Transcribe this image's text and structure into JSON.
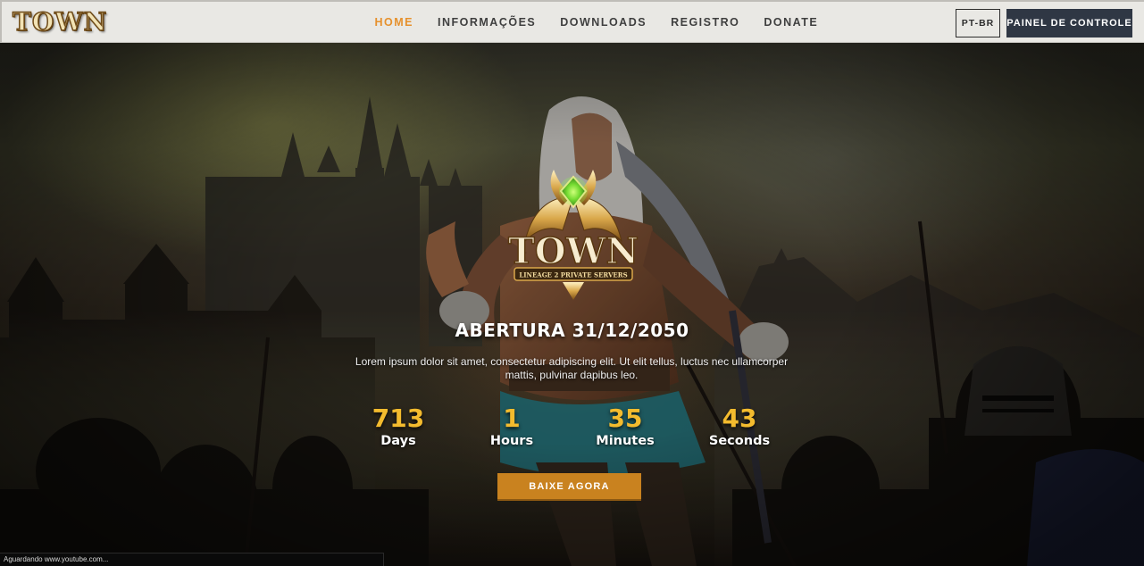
{
  "navbar": {
    "logo_text": "TOWN",
    "links": [
      {
        "label": "HOME",
        "active": true
      },
      {
        "label": "INFORMAÇÕES",
        "active": false
      },
      {
        "label": "DOWNLOADS",
        "active": false
      },
      {
        "label": "REGISTRO",
        "active": false
      },
      {
        "label": "DONATE",
        "active": false
      }
    ],
    "language": "PT-BR",
    "panel_button": "PAINEL DE CONTROLE"
  },
  "hero": {
    "crest": {
      "title": "TOWN",
      "subtitle": "LINEAGE 2 PRIVATE SERVERS"
    },
    "title": "ABERTURA 31/12/2050",
    "description": "Lorem ipsum dolor sit amet, consectetur adipiscing elit. Ut elit tellus, luctus nec ullamcorper mattis, pulvinar dapibus leo.",
    "countdown": {
      "days": {
        "value": "713",
        "label": "Days"
      },
      "hours": {
        "value": "1",
        "label": "Hours"
      },
      "minutes": {
        "value": "35",
        "label": "Minutes"
      },
      "seconds": {
        "value": "43",
        "label": "Seconds"
      }
    },
    "download_button": "BAIXE AGORA"
  },
  "status_bar": {
    "text": "Aguardando www.youtube.com..."
  },
  "colors": {
    "accent": "#e6912d",
    "button_orange": "#c9821f",
    "countdown_gold": "#f3bb2e",
    "panel_dark": "#2f3744",
    "navbar_bg": "#e9e8e4"
  }
}
